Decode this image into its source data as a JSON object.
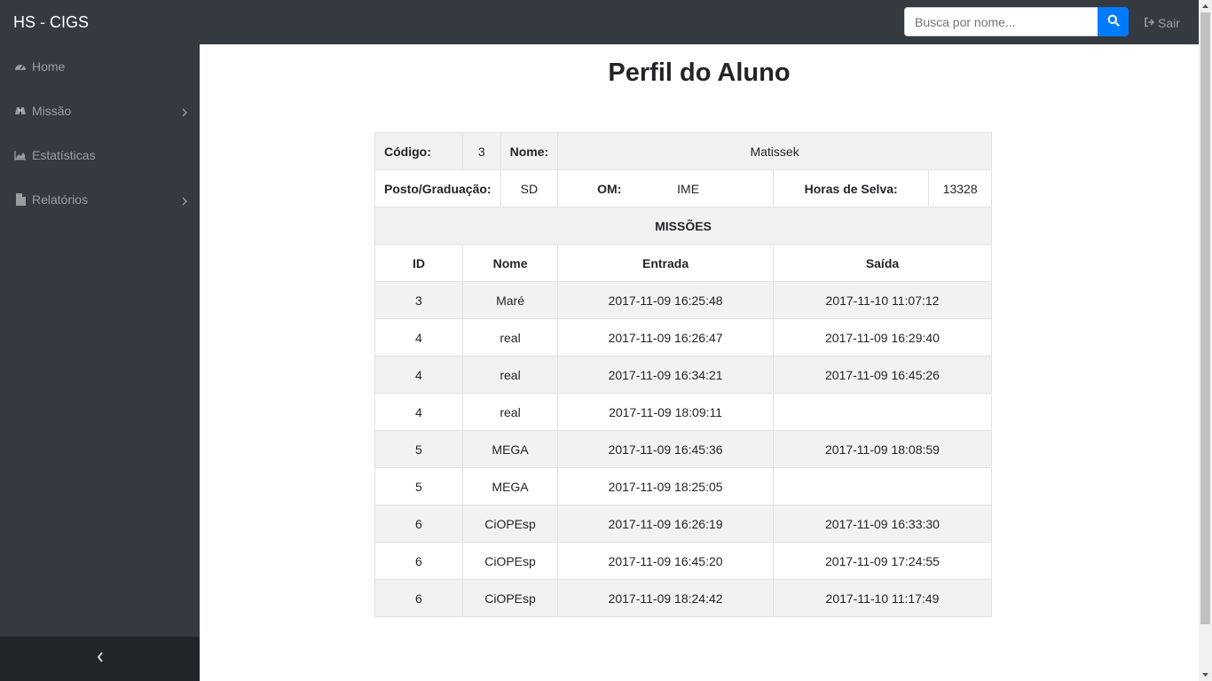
{
  "navbar": {
    "brand": "HS - CIGS",
    "search_placeholder": "Busca por nome...",
    "logout_label": "Sair"
  },
  "sidebar": {
    "items": [
      {
        "label": "Home",
        "icon": "dashboard-icon"
      },
      {
        "label": "Missão",
        "icon": "binoculars-icon",
        "has_submenu": true
      },
      {
        "label": "Estatísticas",
        "icon": "area-chart-icon"
      },
      {
        "label": "Relatórios",
        "icon": "file-icon",
        "has_submenu": true
      }
    ]
  },
  "page": {
    "title": "Perfil do Aluno"
  },
  "student": {
    "codigo_label": "Código:",
    "codigo": "3",
    "nome_label": "Nome:",
    "nome": "Matissek",
    "posto_label": "Posto/Graduação:",
    "posto": "SD",
    "om_label": "OM:",
    "om": "IME",
    "horas_label": "Horas de Selva:",
    "horas": "13328"
  },
  "missions": {
    "section_title": "MISSÕES",
    "headers": [
      "ID",
      "Nome",
      "Entrada",
      "Saída"
    ],
    "rows": [
      [
        "3",
        "Maré",
        "2017-11-09 16:25:48",
        "2017-11-10 11:07:12"
      ],
      [
        "4",
        "real",
        "2017-11-09 16:26:47",
        "2017-11-09 16:29:40"
      ],
      [
        "4",
        "real",
        "2017-11-09 16:34:21",
        "2017-11-09 16:45:26"
      ],
      [
        "4",
        "real",
        "2017-11-09 18:09:11",
        ""
      ],
      [
        "5",
        "MEGA",
        "2017-11-09 16:45:36",
        "2017-11-09 18:08:59"
      ],
      [
        "5",
        "MEGA",
        "2017-11-09 18:25:05",
        ""
      ],
      [
        "6",
        "CiOPEsp",
        "2017-11-09 16:26:19",
        "2017-11-09 16:33:30"
      ],
      [
        "6",
        "CiOPEsp",
        "2017-11-09 16:45:20",
        "2017-11-09 17:24:55"
      ],
      [
        "6",
        "CiOPEsp",
        "2017-11-09 18:24:42",
        "2017-11-10 11:17:49"
      ]
    ]
  },
  "colors": {
    "navbar_bg": "#343a40",
    "sidebar_toggle_bg": "#212529",
    "accent": "#007bff",
    "stripe": "#f2f2f2"
  }
}
